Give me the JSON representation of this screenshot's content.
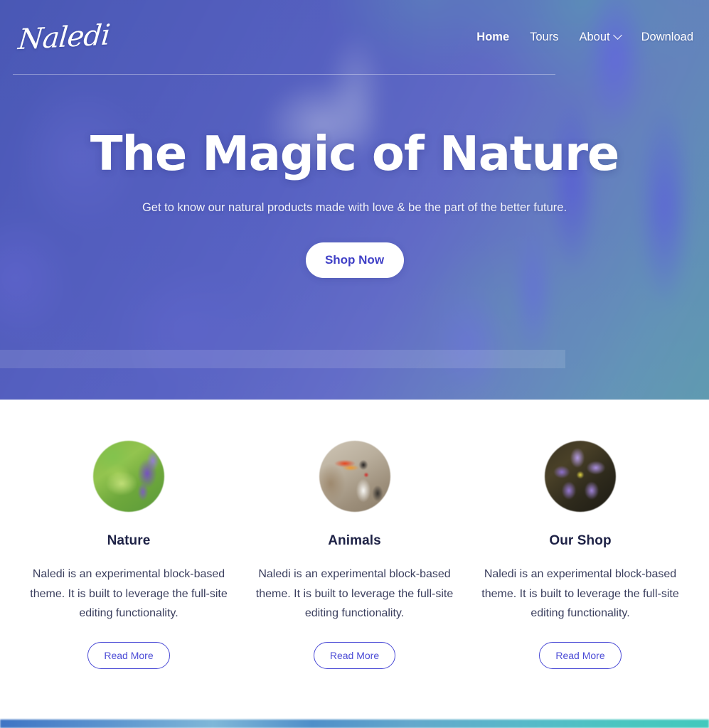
{
  "site": {
    "logo_text": "Naledi"
  },
  "nav": {
    "items": [
      {
        "label": "Home",
        "active": true,
        "has_dropdown": false
      },
      {
        "label": "Tours",
        "active": false,
        "has_dropdown": false
      },
      {
        "label": "About",
        "active": false,
        "has_dropdown": true
      },
      {
        "label": "Download",
        "active": false,
        "has_dropdown": false
      }
    ]
  },
  "hero": {
    "title": "The Magic of Nature",
    "subtitle": "Get to know our natural products made with love & be the part of the better future.",
    "cta_label": "Shop Now",
    "background_image": "blurred-lavender-field-with-butterfly"
  },
  "cards": [
    {
      "title": "Nature",
      "body": "Naledi is an experimental block-based theme. It is built to leverage the full-site editing functionality.",
      "button_label": "Read More",
      "image": "green-butterfly-on-lavender-photo"
    },
    {
      "title": "Animals",
      "body": "Naledi is an experimental block-based theme. It is built to leverage the full-site editing functionality.",
      "button_label": "Read More",
      "image": "red-billed-hornbill-bird-photo"
    },
    {
      "title": "Our Shop",
      "body": "Naledi is an experimental block-based theme. It is built to leverage the full-site editing functionality.",
      "button_label": "Read More",
      "image": "purple-hepatica-flower-photo"
    }
  ],
  "colors": {
    "accent": "#4b4bd6",
    "cta_text": "#3f3fc6",
    "heading": "#1e2246",
    "body_text": "#3b3f5e",
    "hero_overlay": "#4a5bb3",
    "page_background": "#ffffff",
    "bottom_strip_start": "#3f74c4",
    "bottom_strip_end": "#43c9bd"
  }
}
